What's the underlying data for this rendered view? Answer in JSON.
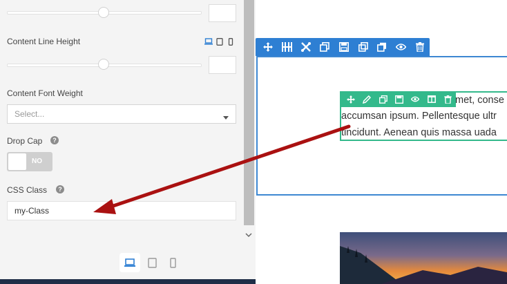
{
  "panel": {
    "line_height_label": "Content Line Height",
    "font_weight_label": "Content Font Weight",
    "font_weight_select_placeholder": "Select...",
    "drop_cap_label": "Drop Cap",
    "drop_cap_toggle": "NO",
    "css_class_label": "CSS Class",
    "css_class_value": "my-Class",
    "help_glyph": "?"
  },
  "canvas": {
    "text_lines": [
      "met, conse",
      "accumsan ipsum. Pellentesque ultr",
      "tincidunt. Aenean quis massa uada"
    ]
  },
  "colors": {
    "row_toolbar": "#2e7fd3",
    "module_toolbar": "#33b98b",
    "annotation_arrow": "#aa1111",
    "bottom_bar": "#1f2d47"
  },
  "icons": {
    "row_toolbar": [
      "move-icon",
      "columns-icon",
      "settings-icon",
      "duplicate-icon",
      "save-icon",
      "copy-icon",
      "paste-icon",
      "visibility-icon",
      "delete-icon"
    ],
    "module_toolbar": [
      "move-icon",
      "edit-icon",
      "duplicate-icon",
      "save-icon",
      "visibility-icon",
      "columns-icon",
      "delete-icon"
    ]
  }
}
